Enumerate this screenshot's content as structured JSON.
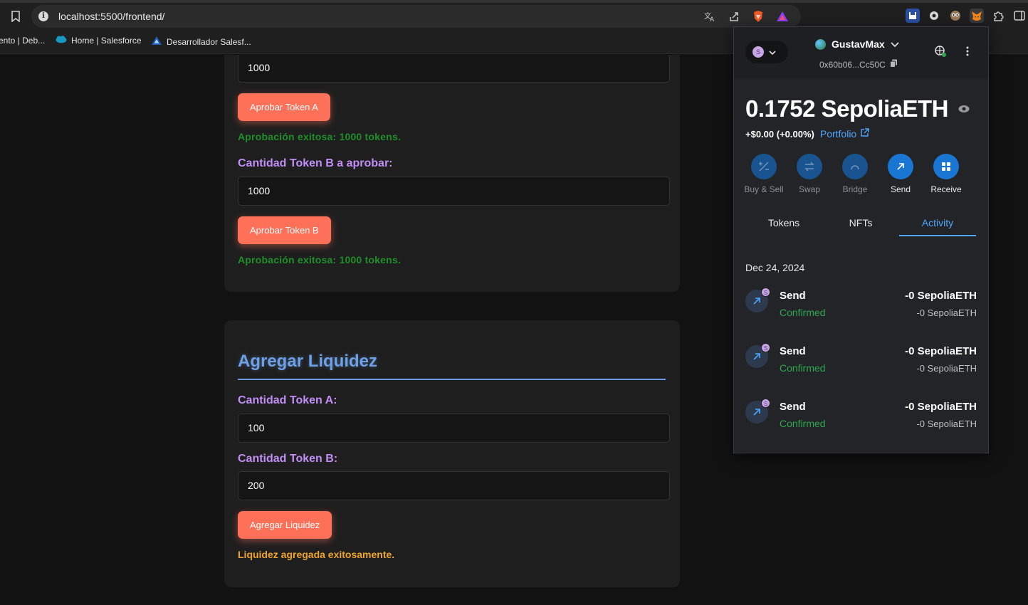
{
  "browser": {
    "url": "localhost:5500/frontend/",
    "bookmarks": [
      "ento | Deb...",
      "Home | Salesforce",
      "Desarrollador Salesf..."
    ]
  },
  "approve": {
    "token_a_value": "1000",
    "token_a_button": "Aprobar Token A",
    "token_a_success": "Aprobación exitosa: 1000 tokens.",
    "token_b_label": "Cantidad Token B a aprobar:",
    "token_b_value": "1000",
    "token_b_button": "Aprobar Token B",
    "token_b_success": "Aprobación exitosa: 1000 tokens."
  },
  "liquidity": {
    "title": "Agregar Liquidez",
    "token_a_label": "Cantidad Token A:",
    "token_a_value": "100",
    "token_b_label": "Cantidad Token B:",
    "token_b_value": "200",
    "button": "Agregar Liquidez",
    "result": "Liquidez agregada exitosamente."
  },
  "wallet": {
    "network_initial": "S",
    "account_name": "GustavMax",
    "address": "0x60b06...Cc50C",
    "balance": "0.1752 SepoliaETH",
    "change": "+$0.00 (+0.00%)",
    "portfolio": "Portfolio",
    "actions": {
      "buy_sell": "Buy & Sell",
      "swap": "Swap",
      "bridge": "Bridge",
      "send": "Send",
      "receive": "Receive"
    },
    "tabs": {
      "tokens": "Tokens",
      "nfts": "NFTs",
      "activity": "Activity"
    },
    "activity_date": "Dec 24, 2024",
    "transactions": [
      {
        "type": "Send",
        "status": "Confirmed",
        "amount": "-0 SepoliaETH",
        "sub": "-0 SepoliaETH"
      },
      {
        "type": "Send",
        "status": "Confirmed",
        "amount": "-0 SepoliaETH",
        "sub": "-0 SepoliaETH"
      },
      {
        "type": "Send",
        "status": "Confirmed",
        "amount": "-0 SepoliaETH",
        "sub": "-0 SepoliaETH"
      }
    ]
  },
  "colors": {
    "button": "#ff7059",
    "success": "#1f8f2a",
    "label": "#c08ef5",
    "title": "#6ea0e6",
    "warning": "#f0a52a",
    "wallet_accent": "#4da6ff",
    "confirmed": "#2ea84f"
  }
}
